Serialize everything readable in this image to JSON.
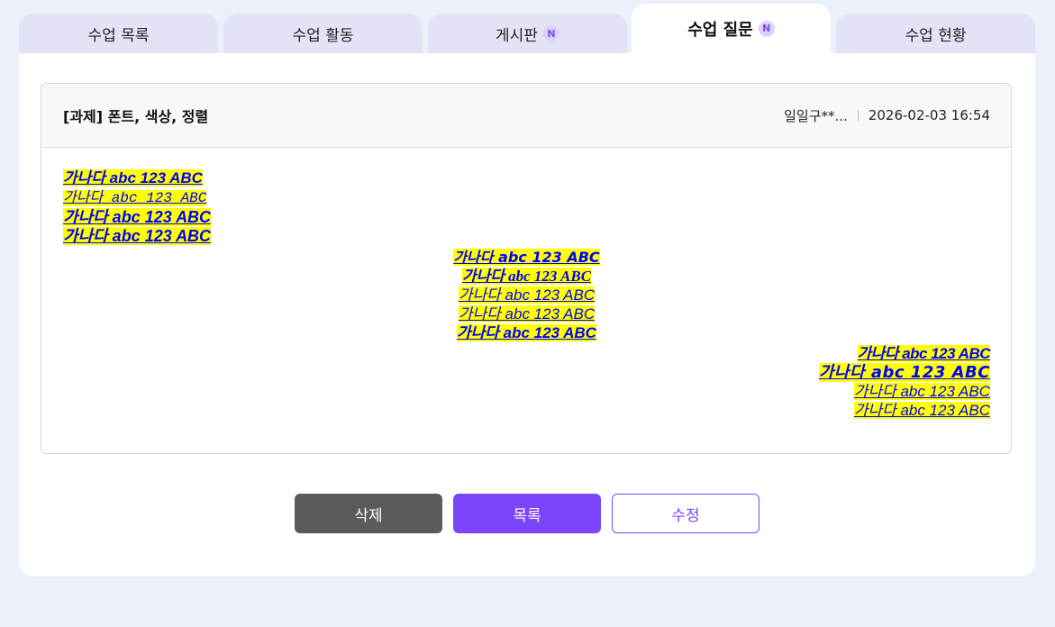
{
  "tabs": [
    {
      "label": "수업 목록",
      "badge": ""
    },
    {
      "label": "수업 활동",
      "badge": ""
    },
    {
      "label": "게시판",
      "badge": "N"
    },
    {
      "label": "수업 질문",
      "badge": "N"
    },
    {
      "label": "수업 현황",
      "badge": ""
    }
  ],
  "post": {
    "title": "[과제] 폰트, 색상, 정렬",
    "author": "일일구**...",
    "datetime": "2026-02-03 16:54",
    "sample_text": "가나다 abc 123 ABC"
  },
  "buttons": {
    "delete": "삭제",
    "list": "목록",
    "edit": "수정"
  },
  "colors": {
    "accent": "#7d45fa",
    "highlight": "#ffff00",
    "sample_text": "#0000ff",
    "delete_button": "#5b5b5b"
  }
}
